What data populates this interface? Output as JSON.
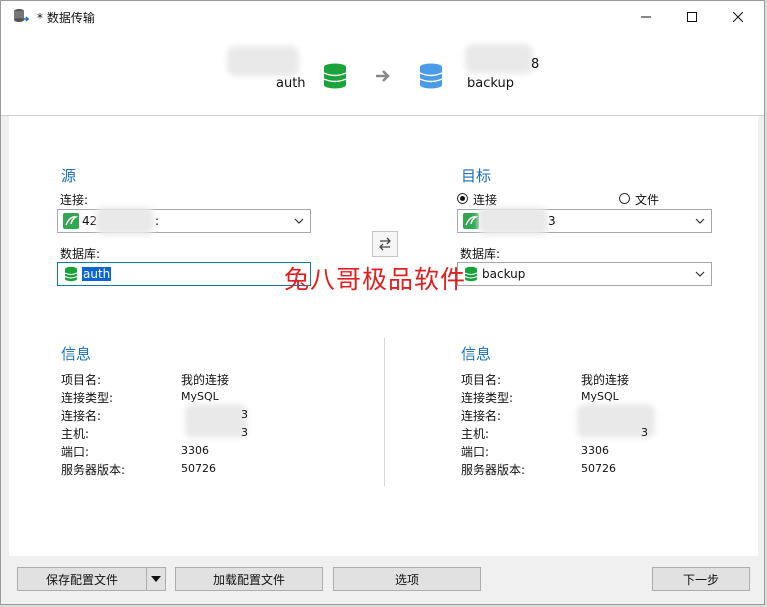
{
  "window": {
    "title": "* 数据传输"
  },
  "header": {
    "source_label": "auth",
    "target_label": "backup",
    "target_suffix": "8"
  },
  "source": {
    "section_title": "源",
    "connection_label": "连接:",
    "connection_value": "42",
    "connection_suffix": ":",
    "database_label": "数据库:",
    "database_value": "auth"
  },
  "target": {
    "section_title": "目标",
    "radio_connection": "连接",
    "radio_file": "文件",
    "connection_suffix": "3",
    "database_label": "数据库:",
    "database_value": "backup"
  },
  "watermark": "兔八哥极品软件",
  "info_left": {
    "title": "信息",
    "rows": [
      {
        "label": "项目名:",
        "value": "我的连接"
      },
      {
        "label": "连接类型:",
        "value": "MySQL"
      },
      {
        "label": "连接名:",
        "value": ""
      },
      {
        "label": "主机:",
        "value": ""
      },
      {
        "label": "端口:",
        "value": "3306"
      },
      {
        "label": "服务器版本:",
        "value": "50726"
      }
    ],
    "conn_suffix": "3",
    "host_suffix": "3"
  },
  "info_right": {
    "title": "信息",
    "rows": [
      {
        "label": "项目名:",
        "value": "我的连接"
      },
      {
        "label": "连接类型:",
        "value": "MySQL"
      },
      {
        "label": "连接名:",
        "value": ""
      },
      {
        "label": "主机:",
        "value": ""
      },
      {
        "label": "端口:",
        "value": "3306"
      },
      {
        "label": "服务器版本:",
        "value": "50726"
      }
    ],
    "host_suffix": "3"
  },
  "footer": {
    "save_profile": "保存配置文件",
    "load_profile": "加载配置文件",
    "options": "选项",
    "next": "下一步"
  },
  "colors": {
    "accent": "#1e6fb5",
    "db_green": "#1aa33a",
    "db_blue": "#4a9be8",
    "watermark": "#e02020"
  }
}
